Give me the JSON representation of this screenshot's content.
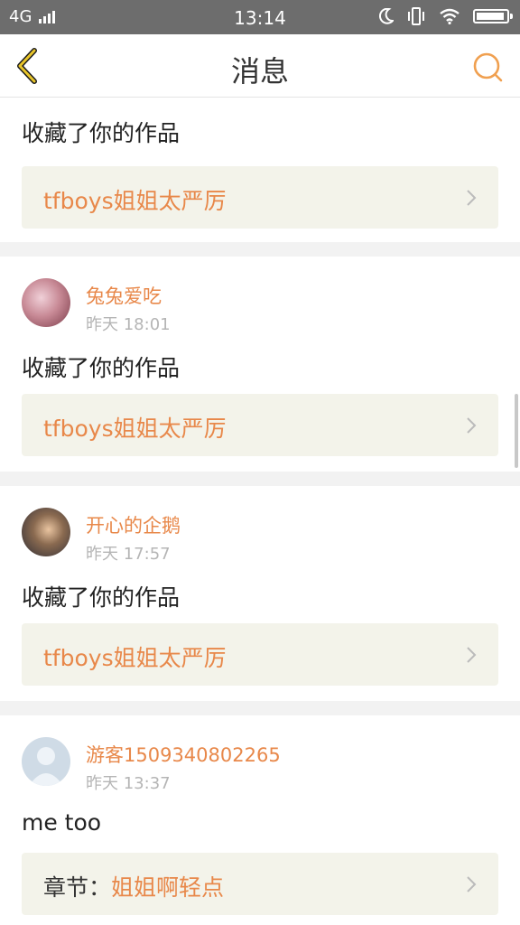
{
  "status_bar": {
    "network": "4G",
    "time": "13:14"
  },
  "nav": {
    "title": "消息"
  },
  "colors": {
    "accent": "#e8884a",
    "status_bar": "#6d6d6d",
    "work_box": "#f3f3ea"
  },
  "messages": [
    {
      "action": "收藏了你的作品",
      "work_title": "tfboys姐姐太严厉"
    },
    {
      "user": "兔兔爱吃",
      "time": "昨天 18:01",
      "action": "收藏了你的作品",
      "work_title": "tfboys姐姐太严厉"
    },
    {
      "user": "开心的企鹅",
      "time": "昨天 17:57",
      "action": "收藏了你的作品",
      "work_title": "tfboys姐姐太严厉"
    },
    {
      "user": "游客1509340802265",
      "time": "昨天 13:37",
      "action": "me too",
      "work_label": "章节：",
      "work_title": "姐姐啊轻点"
    }
  ],
  "icons": [
    "back-arrow-icon",
    "search-icon",
    "chevron-right-icon",
    "moon-icon",
    "vibrate-icon",
    "wifi-icon",
    "battery-icon",
    "signal-icon"
  ]
}
